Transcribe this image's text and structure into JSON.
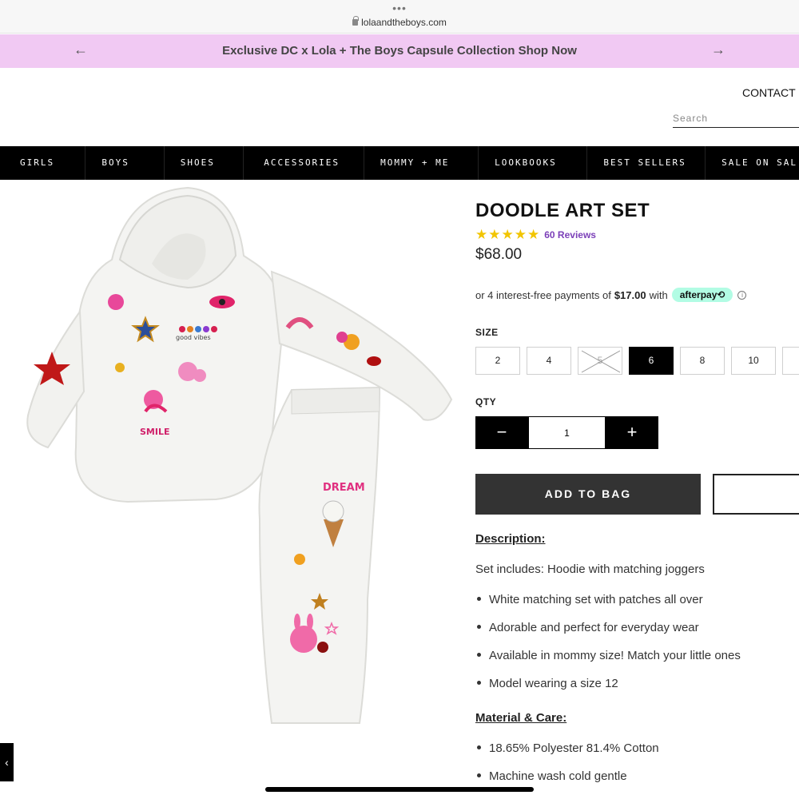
{
  "browser": {
    "dots": "•••",
    "url": "lolaandtheboys.com"
  },
  "promo": {
    "text": "Exclusive DC x Lola + The Boys Capsule Collection Shop Now",
    "left_arrow": "←",
    "right_arrow": "→"
  },
  "header": {
    "contact": "CONTACT U",
    "search_placeholder": "Search"
  },
  "nav": [
    "GIRLS",
    "BOYS",
    "SHOES",
    "ACCESSORIES",
    "MOMMY + ME",
    "LOOKBOOKS",
    "BEST SELLERS",
    "SALE ON SAL"
  ],
  "product": {
    "title": "DOODLE ART SET",
    "rating": 5,
    "reviews": "60 Reviews",
    "price": "$68.00",
    "afterpay": {
      "prefix": "or 4 interest-free payments of",
      "amount": "$17.00",
      "suffix": "with",
      "badge": "afterpay⟲",
      "info": "i"
    },
    "size_label": "SIZE",
    "sizes": [
      {
        "label": "2",
        "state": "available"
      },
      {
        "label": "4",
        "state": "available"
      },
      {
        "label": "5",
        "state": "soldout"
      },
      {
        "label": "6",
        "state": "selected"
      },
      {
        "label": "8",
        "state": "available"
      },
      {
        "label": "10",
        "state": "available"
      }
    ],
    "qty_label": "QTY",
    "qty_minus": "−",
    "qty_value": "1",
    "qty_plus": "+",
    "add_to_bag": "ADD TO BAG",
    "description_heading": "Description:",
    "description_intro": "Set includes: Hoodie with matching joggers",
    "description_bullets": [
      "White matching set with patches all over",
      "Adorable and perfect for everyday wear",
      "Available in mommy size! Match your little ones",
      "Model wearing a size 12"
    ],
    "material_heading": "Material & Care:",
    "material_bullets": [
      "18.65% Polyester 81.4% Cotton",
      "Machine wash cold gentle"
    ],
    "image_text": {
      "smile": "SMILE",
      "dream": "DREAM",
      "good_vibes": "good vibes"
    }
  },
  "side_tab": "‹",
  "colors": {
    "promo_bg": "#f1c9f3",
    "nav_bg": "#000000",
    "star": "#f2c500",
    "reviews": "#7b3fb8",
    "afterpay": "#b2fce4",
    "button": "#333333"
  }
}
